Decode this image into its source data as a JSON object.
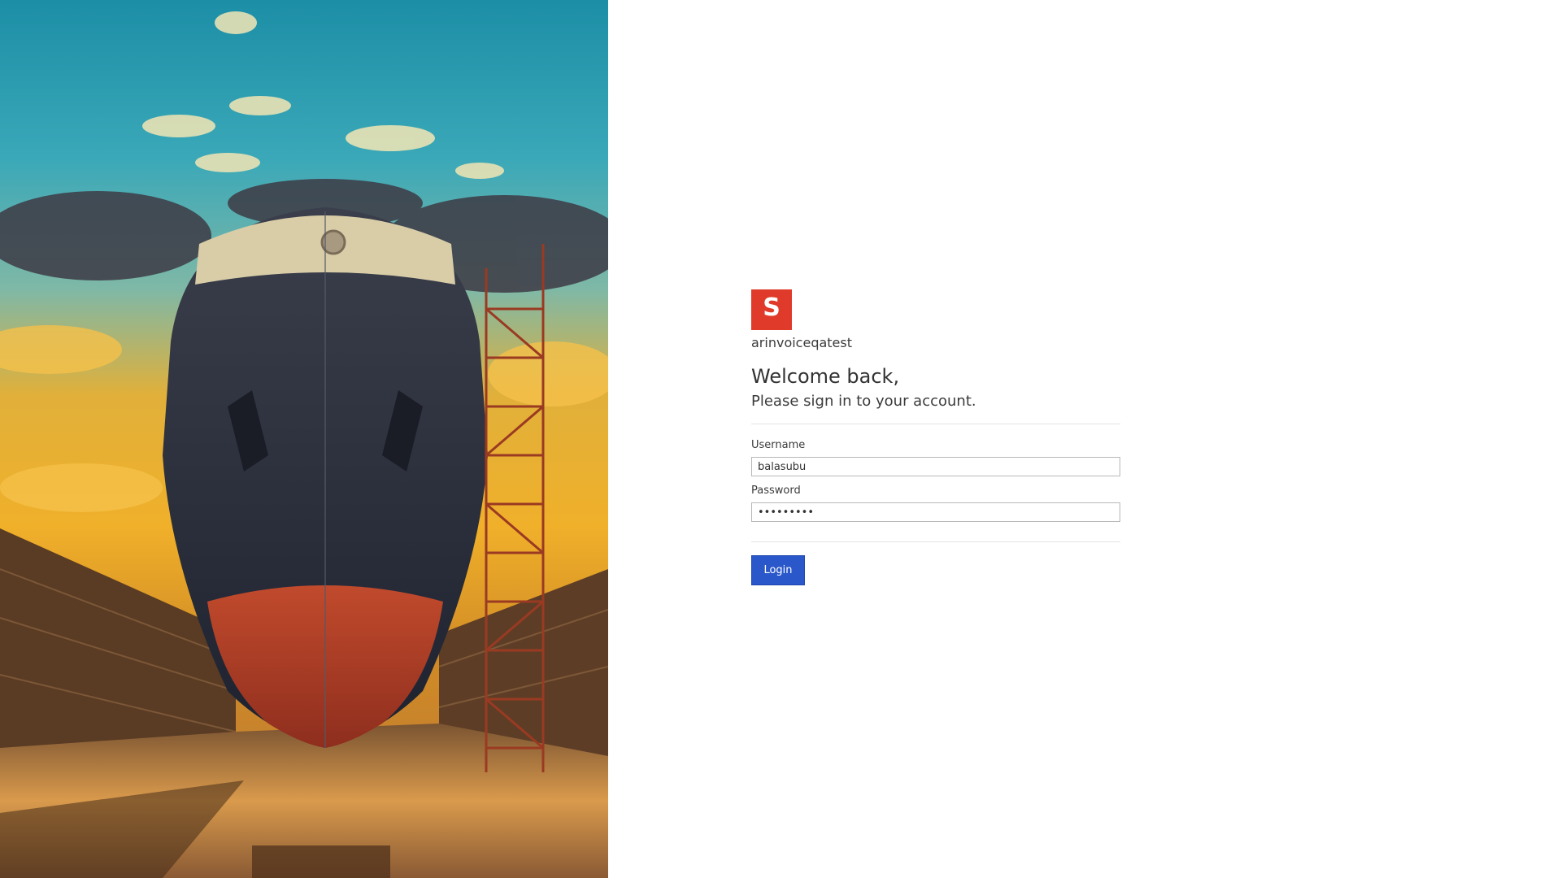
{
  "brand": {
    "logo_letter": "S",
    "logo_color": "#e03a2a",
    "tenant_name": "arinvoiceqatest"
  },
  "heading": {
    "welcome": "Welcome back,",
    "subtitle": "Please sign in to your account."
  },
  "form": {
    "username_label": "Username",
    "username_value": "balasubu",
    "password_label": "Password",
    "password_value": "•••••••••",
    "login_label": "Login",
    "login_color": "#2a57c9"
  }
}
